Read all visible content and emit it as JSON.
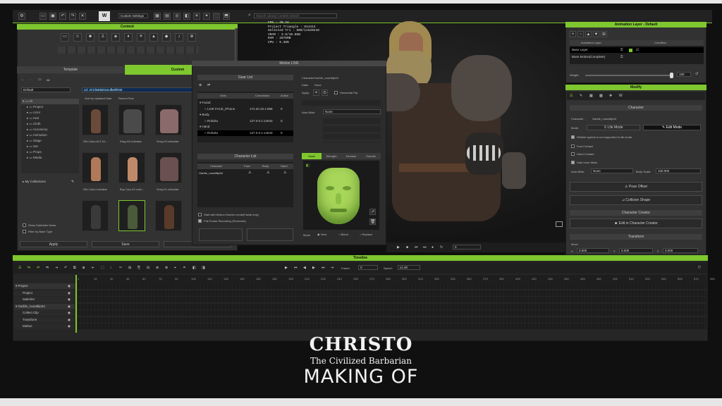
{
  "toolbar": {
    "custom_settings": "Custom Settings",
    "search_placeholder": "Search Library Content Search"
  },
  "content_panel": {
    "title": "Content",
    "tab_template": "Template",
    "tab_custom": "Custom",
    "tab_all": "All",
    "filter": "Default",
    "path": "cd: JCC\\Mobe\\Ucufbel\\R32",
    "sort": "Sort by Updated Date",
    "recent": "Recent First",
    "tree": [
      "All",
      "Project",
      "Actor",
      "Hair",
      "Cloth",
      "Accessory",
      "Animation",
      "Stage",
      "Set",
      "Props",
      "Media"
    ],
    "collections": "My Collections",
    "show_subfolder": "Show Subfolder Items",
    "filter_base": "Filter by Base Type",
    "apply": "Apply",
    "save": "Save",
    "thumbs": [
      {
        "label": "Girl-12yrs-ALT-01..."
      },
      {
        "label": "Dmg-03.ccAvatar"
      },
      {
        "label": "Greg-03.ccAvatar"
      },
      {
        "label": "Girl-12yrs.ccAvatar"
      },
      {
        "label": "Boy-7yrs-02.ccAv..."
      },
      {
        "label": "Greg-01.ccAvatar"
      },
      {
        "label": ""
      },
      {
        "label": ""
      },
      {
        "label": ""
      }
    ]
  },
  "motion_live": {
    "title": "Motion LIVE",
    "gear_list": "Gear List",
    "gear_cols": [
      "Gear",
      "Connection",
      "Action"
    ],
    "gear_rows": [
      {
        "name": "Facial",
        "conn": "",
        "val": "",
        "group": true
      },
      {
        "name": "LIVE FACE_iPhone",
        "conn": "172.20.10.1:999",
        "val": "0",
        "group": false
      },
      {
        "name": "Body",
        "conn": "",
        "val": "",
        "group": true
      },
      {
        "name": "Rokoko",
        "conn": "127.0.0.1:14043",
        "val": "0",
        "group": false
      },
      {
        "name": "Hand",
        "conn": "",
        "val": "",
        "group": true
      },
      {
        "name": "Rokoko",
        "conn": "127.0.0.1:14043",
        "val": "0",
        "group": false
      }
    ],
    "character_list": "Character List",
    "char_cols": [
      "Character",
      "Face",
      "Body",
      "Hand"
    ],
    "char_row": "Garble_roundtiip04",
    "opt_motion_director": "Start with Motion Director mode(Facial only)",
    "opt_full_frame": "Full-Frame Recording (Timecode)",
    "right": {
      "character_label": "Character:",
      "character": "Garble_roundtiip04",
      "data_label": "Data:",
      "data": "None",
      "apply_label": "Apply:",
      "horizontal_flip": "Horizontal Flip",
      "auto_blink_label": "Auto Blink:",
      "auto_blink": "None"
    },
    "tabs": [
      "Mask",
      "Strength",
      "Denoise",
      "Smooth"
    ],
    "mode_label": "Mode",
    "modes": [
      "View",
      "Blend",
      "Replace"
    ]
  },
  "stats": {
    "fps": "FPS : 70.24",
    "triangles": "Project Triangle : 814414",
    "selected": "Selected Tri : 800/11520246",
    "vram": "VRAM : 3.9/10.0GB",
    "ram": "RAM : 2875MB",
    "cpu": "CPU : 6.38%"
  },
  "viewport": {
    "frame_value": "0"
  },
  "anim_layer": {
    "title": "Animation Layer - Default",
    "col_layer": "Animation Layer",
    "col_condition": "Condition",
    "rows": [
      "Base Layer",
      "Base Motion(Complete)"
    ],
    "weight_label": "Weight:",
    "weight_value": "100"
  },
  "modify": {
    "title": "Modify",
    "section_character": "Character",
    "character_label": "Character:",
    "character": "Garble_roundtiip04",
    "mode_label": "Mode:",
    "life_mode": "Life Mode",
    "edit_mode": "Edit Mode",
    "wrinkle": "Wrinkle system is not supported in life mode",
    "foot_contact": "Foot Contact",
    "hand_contact": "Hand Contact",
    "hide_inner": "Hide Inner Mesh",
    "auto_blink_label": "Auto Blink:",
    "auto_blink": "None",
    "body_scale_label": "Body Scale:",
    "body_scale": "100.000",
    "pose_offset": "Pose Offset",
    "collision": "Collision Shape",
    "section_cc": "Character Creator",
    "edit_cc": "Edit in Character Creator",
    "section_transform": "Transform",
    "move": "Move",
    "x_label": "X",
    "x": "0.000",
    "y_label": "Y",
    "y": "0.000",
    "z_label": "Z",
    "z": "0.000"
  },
  "timeline": {
    "title": "Timeline",
    "frame_label": "Frame:",
    "frame": "0",
    "speed_label": "Speed:",
    "speed": "x1.00",
    "tracks": [
      {
        "name": "Project",
        "level": 0
      },
      {
        "name": "Project",
        "level": 1
      },
      {
        "name": "Switcher",
        "level": 1
      },
      {
        "name": "Garble_roundtiip04",
        "level": 0
      },
      {
        "name": "Collect Clip",
        "level": 1
      },
      {
        "name": "Transform",
        "level": 1
      },
      {
        "name": "Motion",
        "level": 1
      }
    ],
    "ruler": [
      "1",
      "15",
      "30",
      "45",
      "60",
      "75",
      "90",
      "105",
      "120",
      "135",
      "150",
      "165",
      "180",
      "195",
      "210",
      "225",
      "240",
      "255",
      "270",
      "285",
      "300",
      "315",
      "330",
      "345",
      "360",
      "375",
      "390",
      "405",
      "420",
      "435",
      "450",
      "465",
      "480",
      "495",
      "510",
      "525",
      "540",
      "555",
      "570",
      "585"
    ]
  },
  "overlay": {
    "line1": "CHRISTO",
    "line2": "The Civilized Barbarian",
    "line3": "MAKING OF"
  },
  "colors": {
    "accent": "#7ec72e",
    "panel": "#323232",
    "bg": "#101010"
  }
}
